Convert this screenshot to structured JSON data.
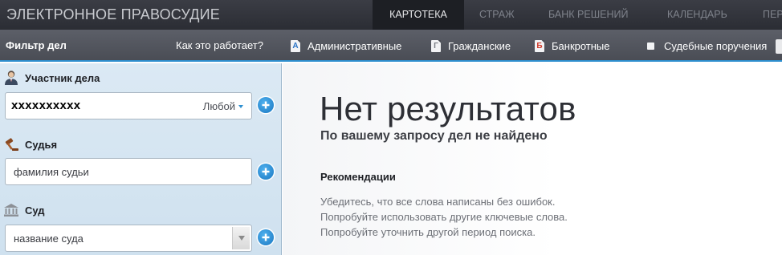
{
  "header": {
    "brand": "ЭЛЕКТРОННОЕ ПРАВОСУДИЕ",
    "tabs": [
      {
        "label": "КАРТОТЕКА",
        "active": true
      },
      {
        "label": "СТРАЖ",
        "active": false
      },
      {
        "label": "БАНК РЕШЕНИЙ",
        "active": false
      },
      {
        "label": "КАЛЕНДАРЬ",
        "active": false
      },
      {
        "label": "ПЕР",
        "active": false
      }
    ]
  },
  "subbar": {
    "filter_title": "Фильтр дел",
    "how_link": "Как это работает?",
    "categories": [
      {
        "badge": "А",
        "label": "Административные",
        "icon": "document-a-icon"
      },
      {
        "badge": "Г",
        "label": "Гражданские",
        "icon": "document-g-icon"
      },
      {
        "badge": "Б",
        "label": "Банкротные",
        "icon": "document-b-icon"
      }
    ],
    "court_orders_label": "Судебные поручения"
  },
  "sidebar": {
    "participant": {
      "label": "Участник дела",
      "icon": "person-icon",
      "value": "xxxxxxxxxx",
      "mode": "Любой"
    },
    "judge": {
      "label": "Судья",
      "icon": "gavel-icon",
      "placeholder": "фамилия судьи"
    },
    "court": {
      "label": "Суд",
      "icon": "courthouse-icon",
      "placeholder": "название суда"
    }
  },
  "results": {
    "title": "Нет результатов",
    "subtitle": "По вашему запросу дел не найдено",
    "recommendations_title": "Рекомендации",
    "tips": [
      "Убедитесь, что все слова написаны без ошибок.",
      "Попробуйте использовать другие ключевые слова.",
      "Попробуйте уточнить другой период поиска."
    ]
  },
  "colors": {
    "accent": "#2e8fd0",
    "topbar": "#2b2d34",
    "subbar": "#4a4d55",
    "sidebar": "#d4e5f2"
  }
}
